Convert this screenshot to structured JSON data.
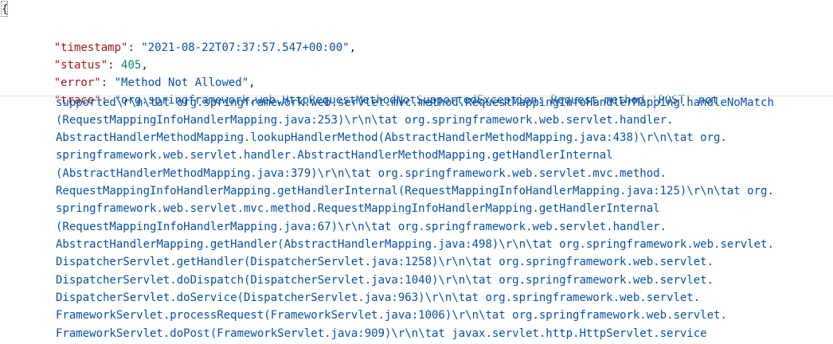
{
  "json_view": {
    "open_brace": "{",
    "fields": {
      "timestamp": {
        "key": "\"timestamp\"",
        "value": "\"2021-08-22T07:37:57.547+00:00\""
      },
      "status": {
        "key": "\"status\"",
        "value": "405"
      },
      "error": {
        "key": "\"error\"",
        "value": "\"Method Not Allowed\""
      },
      "trace": {
        "key": "\"trace\""
      }
    },
    "separator": ": ",
    "comma": ",",
    "trace_lines": [
      "\"org.springframework.web.HttpRequestMethodNotSupportedException: Request method 'POST' not",
      "supported\\r\\n\\tat org.springframework.web.servlet.mvc.method.RequestMappingInfoHandlerMapping.handleNoMatch",
      "(RequestMappingInfoHandlerMapping.java:253)\\r\\n\\tat org.springframework.web.servlet.handler.",
      "AbstractHandlerMethodMapping.lookupHandlerMethod(AbstractHandlerMethodMapping.java:438)\\r\\n\\tat org.",
      "springframework.web.servlet.handler.AbstractHandlerMethodMapping.getHandlerInternal",
      "(AbstractHandlerMethodMapping.java:379)\\r\\n\\tat org.springframework.web.servlet.mvc.method.",
      "RequestMappingInfoHandlerMapping.getHandlerInternal(RequestMappingInfoHandlerMapping.java:125)\\r\\n\\tat org.",
      "springframework.web.servlet.mvc.method.RequestMappingInfoHandlerMapping.getHandlerInternal",
      "(RequestMappingInfoHandlerMapping.java:67)\\r\\n\\tat org.springframework.web.servlet.handler.",
      "AbstractHandlerMapping.getHandler(AbstractHandlerMapping.java:498)\\r\\n\\tat org.springframework.web.servlet.",
      "DispatcherServlet.getHandler(DispatcherServlet.java:1258)\\r\\n\\tat org.springframework.web.servlet.",
      "DispatcherServlet.doDispatch(DispatcherServlet.java:1040)\\r\\n\\tat org.springframework.web.servlet.",
      "DispatcherServlet.doService(DispatcherServlet.java:963)\\r\\n\\tat org.springframework.web.servlet.",
      "FrameworkServlet.processRequest(FrameworkServlet.java:1006)\\r\\n\\tat org.springframework.web.servlet.",
      "FrameworkServlet.doPost(FrameworkServlet.java:909)\\r\\n\\tat javax.servlet.http.HttpServlet.service"
    ],
    "colors": {
      "key": "#a31515",
      "string": "#0451a5",
      "number": "#098658"
    }
  }
}
